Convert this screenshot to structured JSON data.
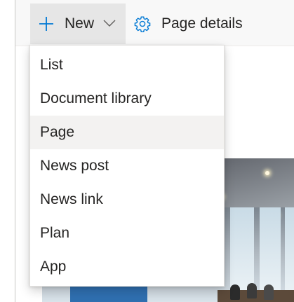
{
  "command_bar": {
    "new_label": "New",
    "page_details_label": "Page details",
    "icons": {
      "new": "plus-icon",
      "new_dropdown": "chevron-down-icon",
      "page_details": "gear-icon"
    },
    "accent_color": "#0078d4"
  },
  "new_menu": {
    "highlighted_index": 2,
    "items": [
      {
        "label": "List"
      },
      {
        "label": "Document library"
      },
      {
        "label": "Page"
      },
      {
        "label": "News post"
      },
      {
        "label": "News link"
      },
      {
        "label": "Plan"
      },
      {
        "label": "App"
      }
    ]
  }
}
